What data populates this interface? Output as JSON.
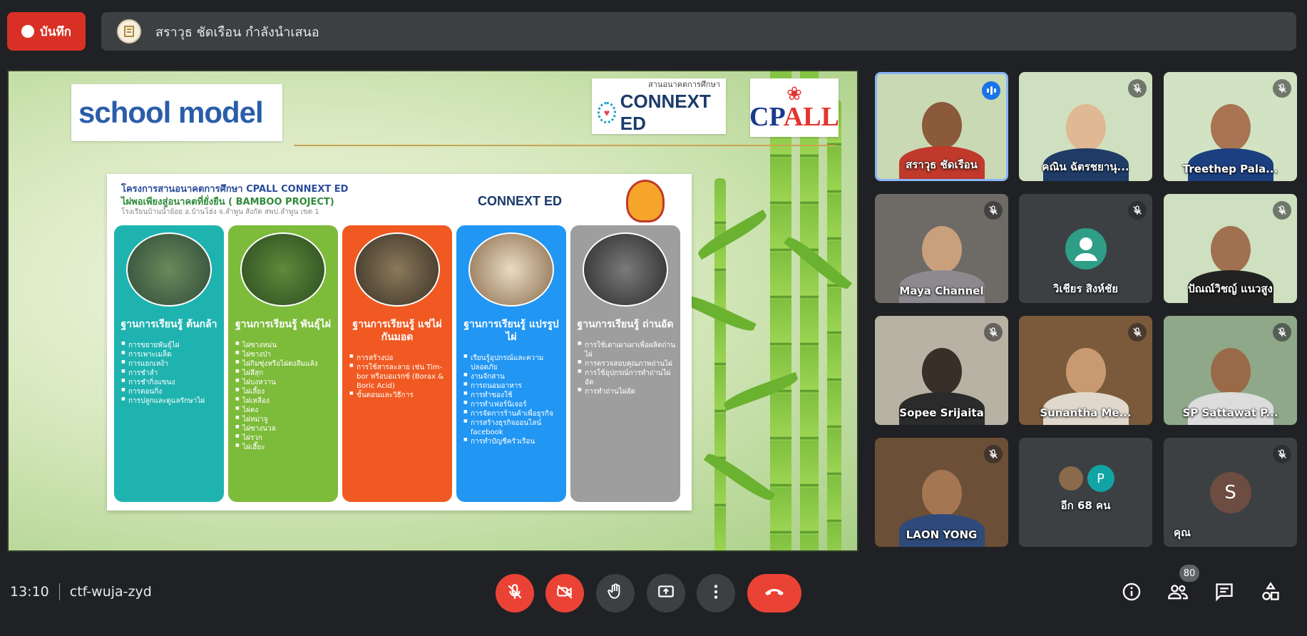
{
  "top_bar": {
    "record_label": "บันทึก",
    "presenter_text": "สราวุธ ชัดเรือน กำลังนำเสนอ"
  },
  "slide": {
    "title": "school model",
    "connext_logo": {
      "top": "สานอนาคตการศึกษา",
      "main": "CONNEXT ED"
    },
    "cpall_logo": {
      "text_cp": "CP",
      "text_all": "ALL"
    },
    "panel": {
      "header_line1": "โครงการสานอนาคตการศึกษา CPALL CONNEXT ED",
      "header_line2": "ไผ่พอเพียงสู่อนาคตที่ยั่งยืน ( BAMBOO PROJECT)",
      "header_line3": "โรงเรียนบ้านน้ำย้อย อ.บ้านโฮ่ง จ.ลำพูน   สังกัด สพป.ลำพูน เขต 1",
      "logo": "CONNEXT ED",
      "columns": [
        {
          "title": "ฐานการเรียนรู้ ต้นกล้า",
          "color": "#1fb3b0",
          "items": [
            "การขยายพันธุ์ไผ่",
            "การเพาะเมล็ด",
            "การแยกเหง้า",
            "การชำลำ",
            "การชำกิ่งแขนง",
            "การตอนกิ่ง",
            "การปลูกและดูแลรักษาไผ่"
          ]
        },
        {
          "title": "ฐานการเรียนรู้ พันธุ์ไผ่",
          "color": "#7dbb3a",
          "items": [
            "ไผ่ซางหม่น",
            "ไผ่ซางป่า",
            "ไผ่กิมซุ่งหรือไผ่ตงลืมแล้ง",
            "ไผ่สีสุก",
            "ไผ่บงหวาน",
            "ไผ่เลี้ยง",
            "ไผ่เหลือง",
            "ไผ่ตง",
            "ไผ่หม่าจู",
            "ไผ่ซางนวล",
            "ไผ่รวก",
            "ไผ่เฮี๊ยะ"
          ]
        },
        {
          "title": "ฐานการเรียนรู้ แช่ไผ่กันมอด",
          "color": "#f05a22",
          "items": [
            "การสร้างบ่อ",
            "การใช้สารละลาย เช่น Tim-bor หรือบอแรกซ์ (Borax & Boric Acid)",
            "ขั้นตอนและวิธีการ"
          ]
        },
        {
          "title": "ฐานการเรียนรู้ แปรรูปไผ่",
          "color": "#2196f3",
          "items": [
            "เรียนรู้อุปกรณ์และความปลอดภัย",
            "งานจักสาน",
            "การถนอมอาหาร",
            "การทำของใช้",
            "การทำเฟอร์นิเจอร์",
            "การจัดการร้านค้าเพื่อธุรกิจ",
            "การสร้างธุรกิจออนไลน์ facebook",
            "การทำบัญชีครัวเรือน"
          ]
        },
        {
          "title": "ฐานการเรียนรู้ ถ่านอัด",
          "color": "#9e9e9e",
          "items": [
            "การใช้เตาเผาเผาเพื่อผลิตถ่านไผ่",
            "การตรวจสอบคุณภาพถ่านไผ่",
            "การใช้อุปกรณ์การทำถ่านไผ่อัด",
            "การทำถ่านไผ่อัด"
          ]
        }
      ]
    }
  },
  "participants": [
    {
      "name": "สราวุธ ชัดเรือน",
      "speaking": true,
      "bg": "#c9d9b4",
      "skin": "#8a5a3a",
      "shirt": "#c0392b"
    },
    {
      "name": "คณิน ฉัตรชยานุ...",
      "muted": true,
      "bg": "#cfe0c0",
      "skin": "#e0b894",
      "shirt": "#1f3b66"
    },
    {
      "name": "Treethep Pala...",
      "muted": true,
      "bg": "#d2e3c4",
      "skin": "#a87452",
      "shirt": "#1c3f80"
    },
    {
      "name": "Maya Channel",
      "muted": true,
      "bg": "#6e6a66",
      "skin": "#c9a07c",
      "shirt": "#8d8a8f"
    },
    {
      "name": "วิเชียร สิงห์ชัย",
      "muted": true,
      "avatar": true,
      "avatar_color": "#2e9e86"
    },
    {
      "name": "ปัณณ์วิชญ์ แนวสูง",
      "muted": true,
      "bg": "#cfe0c0",
      "skin": "#a07050",
      "shirt": "#222222"
    },
    {
      "name": "Sopee Srijaita",
      "muted": true,
      "bg": "#b8b2a4",
      "skin": "#3a2e28",
      "shirt": "#2b2b2b"
    },
    {
      "name": "Sunantha Me...",
      "muted": true,
      "bg": "#7a5a3a",
      "skin": "#c99a72",
      "shirt": "#e0d8cc"
    },
    {
      "name": "SP Sattawat P...",
      "muted": true,
      "bg": "#8fa88a",
      "skin": "#9a6a48",
      "shirt": "#dcdcdc"
    },
    {
      "name": "LAON YONG",
      "muted": true,
      "bg": "#6b4f36",
      "skin": "#a57652",
      "shirt": "#2f4a7a"
    },
    {
      "name": "อีก 68 คน",
      "others": true,
      "mini": "P"
    },
    {
      "name": "คุณ",
      "muted": true,
      "self": true,
      "initial": "S",
      "avatar_color": "#6d4c41"
    }
  ],
  "bottom_bar": {
    "time": "13:10",
    "meeting_code": "ctf-wuja-zyd",
    "people_count": "80"
  },
  "icons": {
    "mic_off": "mic-off-icon",
    "camera_off": "camera-off-icon",
    "raise_hand": "raise-hand-icon",
    "present": "present-icon",
    "more": "more-options-icon",
    "leave": "leave-call-icon",
    "info": "info-icon",
    "people": "people-icon",
    "chat": "chat-icon",
    "activities": "activities-icon"
  }
}
